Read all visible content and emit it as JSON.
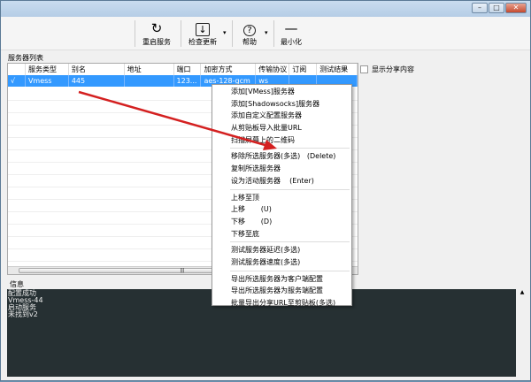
{
  "window": {
    "controls": [
      "minimize",
      "maximize",
      "close"
    ]
  },
  "toolbar": [
    {
      "label": "重启服务",
      "icon": "refresh-icon"
    },
    {
      "label": "检查更新",
      "icon": "download-icon"
    },
    {
      "label": "帮助",
      "icon": "help-icon"
    },
    {
      "label": "最小化",
      "icon": "minimize-icon"
    }
  ],
  "server_list": {
    "title": "服务器列表",
    "columns": [
      "",
      "服务类型",
      "别名",
      "地址",
      "端口",
      "加密方式",
      "传输协议",
      "订阅",
      "测试结果"
    ],
    "rows": [
      [
        "√",
        "Vmess",
        "445",
        "",
        "123...",
        "aes-128-gcm",
        "ws",
        "",
        ""
      ]
    ]
  },
  "show_share": "显示分享内容",
  "info": {
    "title": "信息",
    "lines": [
      "配置成功",
      "Vmess-44",
      "启动服务",
      "未找到v2"
    ]
  },
  "context_menu": {
    "groups": [
      [
        "添加[VMess]服务器",
        "添加[Shadowsocks]服务器",
        "添加自定义配置服务器",
        "从剪贴板导入批量URL",
        "扫描屏幕上的二维码"
      ],
      [
        "移除所选服务器(多选)   (Delete)",
        "复制所选服务器",
        "设为活动服务器    (Enter)"
      ],
      [
        "上移至顶",
        "上移       (U)",
        "下移       (D)",
        "下移至底"
      ],
      [
        "测试服务器延迟(多选)",
        "测试服务器速度(多选)"
      ],
      [
        "导出所选服务器为客户端配置",
        "导出所选服务器为服务端配置",
        "批量导出分享URL至剪贴板(多选)"
      ]
    ]
  },
  "annotation_color": "#d42020"
}
